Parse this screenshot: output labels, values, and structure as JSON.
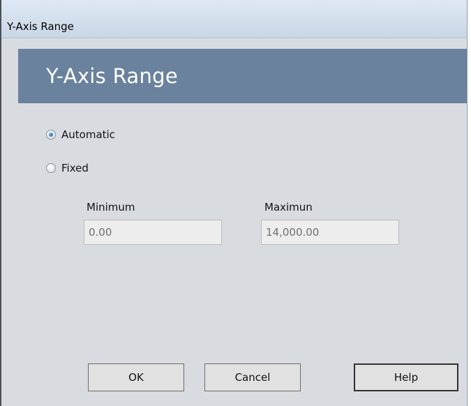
{
  "window": {
    "title": "Y-Axis Range"
  },
  "banner": {
    "title": "Y-Axis Range"
  },
  "range_mode": {
    "options": [
      {
        "label": "Automatic",
        "selected": true
      },
      {
        "label": "Fixed",
        "selected": false
      }
    ]
  },
  "fields": {
    "minimum": {
      "label": "Minimum",
      "value": "0.00"
    },
    "maximum": {
      "label": "Maximun",
      "value": "14,000.00"
    }
  },
  "buttons": {
    "ok": "OK",
    "cancel": "Cancel",
    "help": "Help"
  },
  "colors": {
    "banner": "#6a829e",
    "dialog_background": "#d8dce1",
    "titlebar": "#d2deeb"
  }
}
